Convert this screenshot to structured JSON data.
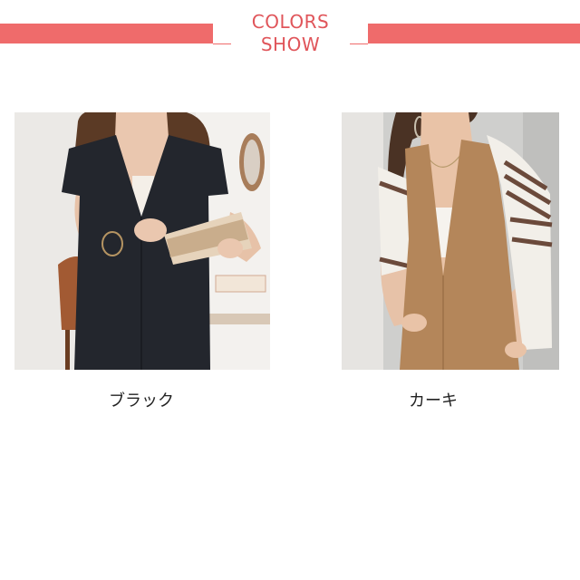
{
  "header": {
    "title_line1": "COLORS",
    "title_line2": "SHOW",
    "accent_color": "#ef6b6b"
  },
  "variants": [
    {
      "label": "ブラック",
      "color": "#23262d"
    },
    {
      "label": "カーキ",
      "color": "#b4865a"
    }
  ]
}
